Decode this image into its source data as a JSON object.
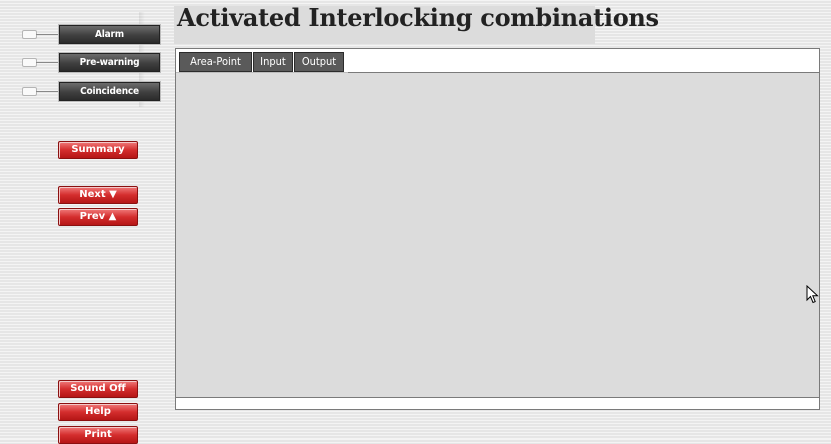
{
  "sidebar": {
    "status_buttons": [
      {
        "label": "Alarm"
      },
      {
        "label": "Pre-warning"
      },
      {
        "label": "Coincidence"
      }
    ],
    "summary_label": "Summary",
    "next_label": "Next ▼",
    "prev_label": "Prev ▲",
    "sound_label": "Sound Off",
    "help_label": "Help",
    "print_label": "Print"
  },
  "header": {
    "title": "Activated Interlocking combinations"
  },
  "tabs": [
    {
      "label": "Area-Point"
    },
    {
      "label": "Input"
    },
    {
      "label": "Output"
    }
  ],
  "icons": {
    "cursor": "mouse-pointer-icon"
  },
  "colors": {
    "red_button": "#d42d2d",
    "dark_button": "#3f3f3f",
    "content_background": "#dcdcdc"
  }
}
